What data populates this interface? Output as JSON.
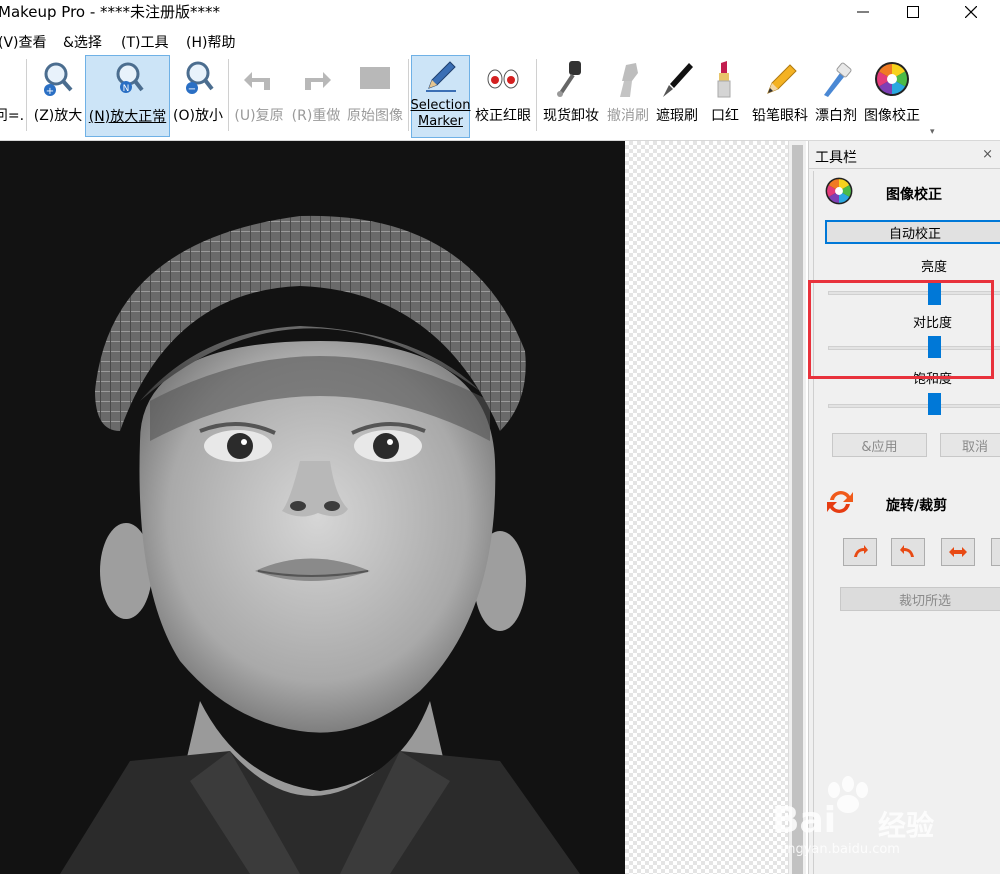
{
  "window": {
    "title": "Makeup Pro - ****未注册版****",
    "controls": [
      "minimize",
      "maximize",
      "close"
    ]
  },
  "menu": [
    {
      "label": "(V)查看"
    },
    {
      "label": "&选择"
    },
    {
      "label": "(T)工具"
    },
    {
      "label": "(H)帮助"
    }
  ],
  "toolbar": {
    "left_fragment": "问=.",
    "items": [
      {
        "label": "(Z)放大",
        "icon": "zoom-in-icon",
        "enabled": true
      },
      {
        "label": "(N)放大正常",
        "icon": "zoom-normal-icon",
        "enabled": true,
        "active": true
      },
      {
        "label": "(O)放小",
        "icon": "zoom-out-icon",
        "enabled": true
      },
      {
        "label": "(U)复原",
        "icon": "undo-icon",
        "enabled": false
      },
      {
        "label": "(R)重做",
        "icon": "redo-icon",
        "enabled": false
      },
      {
        "label": "原始图像",
        "icon": "original-image-icon",
        "enabled": false
      },
      {
        "label_line1": "Selection",
        "label_line2": "Marker",
        "icon": "selection-marker-icon",
        "enabled": true,
        "active": true
      },
      {
        "label": "校正红眼",
        "icon": "red-eye-icon",
        "enabled": true
      },
      {
        "label": "现货卸妆",
        "icon": "makeup-remover-icon",
        "enabled": true
      },
      {
        "label": "撤消刷",
        "icon": "undo-brush-icon",
        "enabled": false
      },
      {
        "label": "遮瑕刷",
        "icon": "concealer-brush-icon",
        "enabled": true
      },
      {
        "label": "口红",
        "icon": "lipstick-icon",
        "enabled": true
      },
      {
        "label": "铅笔眼科",
        "icon": "pencil-eyeliner-icon",
        "enabled": true
      },
      {
        "label": "漂白剂",
        "icon": "whitening-icon",
        "enabled": true
      },
      {
        "label": "图像校正",
        "icon": "color-wheel-icon",
        "enabled": true
      }
    ]
  },
  "panel": {
    "title": "工具栏",
    "close": "×",
    "image_correction": {
      "title": "图像校正",
      "auto_button": "自动校正",
      "sliders": [
        {
          "label": "亮度",
          "value": 0.5
        },
        {
          "label": "对比度",
          "value": 0.5
        },
        {
          "label": "饱和度",
          "value": 0.5
        }
      ],
      "apply_button": "&应用",
      "cancel_button": "取消"
    },
    "rotate_crop": {
      "title": "旋转/裁剪",
      "buttons": [
        "rotate-left-icon",
        "rotate-right-icon",
        "flip-horizontal-icon",
        "more-icon"
      ],
      "crop_button": "裁切所选"
    }
  },
  "watermark": {
    "brand": "Bai",
    "brand_suffix": "经验",
    "url": "jingyan.baidu.com"
  },
  "colors": {
    "accent": "#0078d7",
    "highlight_box": "#e8323c",
    "active_tool_bg": "#cce4f7"
  }
}
